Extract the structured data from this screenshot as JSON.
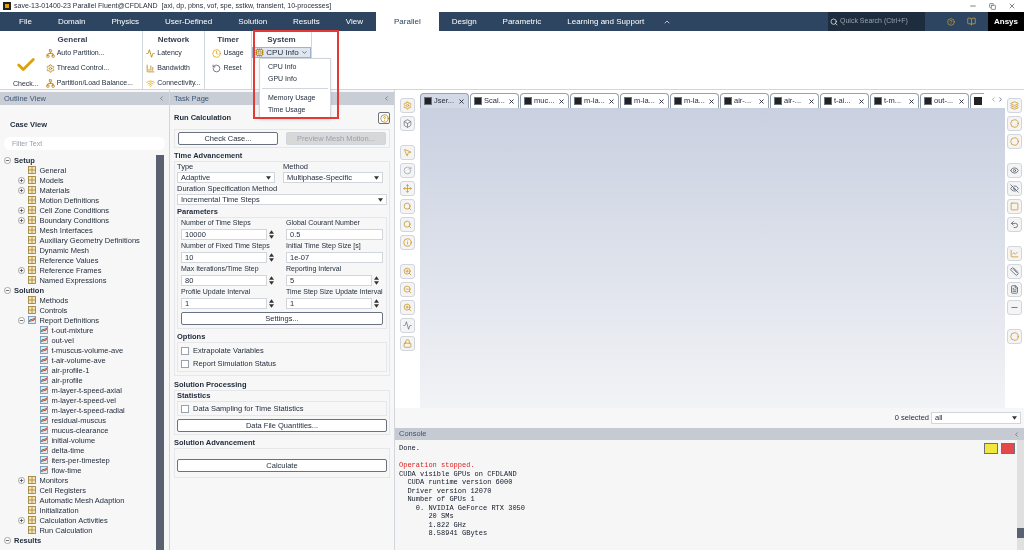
{
  "window": {
    "title": "save-13-01400-23 Parallel Fluent@CFDLAND  [axi, dp, pbns, vof, spe, sstkw, transient, 10-processes]"
  },
  "menu_tabs": [
    {
      "label": "File",
      "selected": false
    },
    {
      "label": "Domain",
      "selected": false
    },
    {
      "label": "Physics",
      "selected": false
    },
    {
      "label": "User-Defined",
      "selected": false
    },
    {
      "label": "Solution",
      "selected": false
    },
    {
      "label": "Results",
      "selected": false
    },
    {
      "label": "View",
      "selected": false
    },
    {
      "label": "Parallel",
      "selected": true
    },
    {
      "label": "Design",
      "selected": false
    },
    {
      "label": "Parametric",
      "selected": false
    },
    {
      "label": "Learning and Support",
      "selected": false
    }
  ],
  "quick_search": {
    "placeholder": "Quick Search (Ctrl+F)"
  },
  "brand": "Ansys",
  "ribbon_groups": [
    {
      "title": "General",
      "items": [
        {
          "label": "Check...",
          "kind": "check"
        },
        {
          "label": "Auto Partition...",
          "kind": "partition"
        },
        {
          "label": "Thread Control...",
          "kind": "thread"
        },
        {
          "label": "Partition/Load Balance...",
          "kind": "balance"
        }
      ]
    },
    {
      "title": "Network",
      "items": [
        {
          "label": "Latency",
          "kind": "latency"
        },
        {
          "label": "Bandwidth",
          "kind": "bandwidth"
        },
        {
          "label": "Connectivity...",
          "kind": "wifi"
        }
      ]
    },
    {
      "title": "Timer",
      "items": [
        {
          "label": "Usage",
          "kind": "usage"
        },
        {
          "label": "Reset",
          "kind": "reset"
        }
      ]
    },
    {
      "title": "System",
      "items": [
        {
          "label": "CPU Info",
          "kind": "dropdown",
          "expanded": true
        }
      ]
    }
  ],
  "system_menu": {
    "option_groups": [
      [
        "CPU Info",
        "GPU Info"
      ],
      [
        "Memory Usage",
        "Time Usage"
      ]
    ]
  },
  "outline_view": {
    "title": "Outline View",
    "subtitle": "Case View",
    "filter": {
      "placeholder": "Filter Text"
    },
    "tree": [
      {
        "label": "Setup",
        "kind": "section",
        "expanded": true,
        "children": [
          {
            "label": "General",
            "kind": "item"
          },
          {
            "label": "Models",
            "kind": "item",
            "expanded": false
          },
          {
            "label": "Materials",
            "kind": "item",
            "expanded": false
          },
          {
            "label": "Motion Definitions",
            "kind": "item"
          },
          {
            "label": "Cell Zone Conditions",
            "kind": "item",
            "expanded": false
          },
          {
            "label": "Boundary Conditions",
            "kind": "item",
            "expanded": false
          },
          {
            "label": "Mesh Interfaces",
            "kind": "item"
          },
          {
            "label": "Auxiliary Geometry Definitions",
            "kind": "item"
          },
          {
            "label": "Dynamic Mesh",
            "kind": "item"
          },
          {
            "label": "Reference Values",
            "kind": "item"
          },
          {
            "label": "Reference Frames",
            "kind": "item",
            "expanded": false
          },
          {
            "label": "Named Expressions",
            "kind": "item"
          }
        ]
      },
      {
        "label": "Solution",
        "kind": "section",
        "expanded": true,
        "children": [
          {
            "label": "Methods",
            "kind": "item"
          },
          {
            "label": "Controls",
            "kind": "item"
          },
          {
            "label": "Report Definitions",
            "kind": "report",
            "expanded": true,
            "children": [
              {
                "label": "t-out-mixture",
                "kind": "report"
              },
              {
                "label": "out-vel",
                "kind": "report"
              },
              {
                "label": "t-muscus-volume-ave",
                "kind": "report"
              },
              {
                "label": "t-air-volume-ave",
                "kind": "report"
              },
              {
                "label": "air-profile-1",
                "kind": "report"
              },
              {
                "label": "air-profile",
                "kind": "report"
              },
              {
                "label": "m-layer-t-speed-axial",
                "kind": "report"
              },
              {
                "label": "m-layer-t-speed-vel",
                "kind": "report"
              },
              {
                "label": "m-layer-t-speed-radial",
                "kind": "report"
              },
              {
                "label": "residual-muscus",
                "kind": "report"
              },
              {
                "label": "mucus-clearance",
                "kind": "report"
              },
              {
                "label": "initial-volume",
                "kind": "report"
              },
              {
                "label": "delta-time",
                "kind": "report"
              },
              {
                "label": "iters-per-timestep",
                "kind": "report"
              },
              {
                "label": "flow-time",
                "kind": "report"
              }
            ]
          },
          {
            "label": "Monitors",
            "kind": "item",
            "expanded": false
          },
          {
            "label": "Cell Registers",
            "kind": "item"
          },
          {
            "label": "Automatic Mesh Adaption",
            "kind": "item"
          },
          {
            "label": "Initialization",
            "kind": "item"
          },
          {
            "label": "Calculation Activities",
            "kind": "item",
            "expanded": false
          },
          {
            "label": "Run Calculation",
            "kind": "item"
          }
        ]
      },
      {
        "label": "Results",
        "kind": "section",
        "expanded": true
      }
    ]
  },
  "task_page": {
    "title": "Task Page",
    "heading": "Run Calculation",
    "top_buttons": [
      {
        "label": "Check Case...",
        "disabled": false
      },
      {
        "label": "Preview Mesh Motion...",
        "disabled": true
      }
    ],
    "time_advancement": {
      "title": "Time Advancement",
      "type": {
        "label": "Type",
        "value": "Adaptive"
      },
      "method": {
        "label": "Method",
        "value": "Multiphase-Specific"
      },
      "duration": {
        "label": "Duration Specification Method",
        "value": "Incremental Time Steps"
      }
    },
    "parameters": {
      "title": "Parameters",
      "fields": [
        {
          "label": "Number of Time Steps",
          "value": "10000",
          "kind": "spinner"
        },
        {
          "label": "Global Courant Number",
          "value": "0.5",
          "kind": "text"
        },
        {
          "label": "Number of Fixed Time Steps",
          "value": "10",
          "kind": "spinner"
        },
        {
          "label": "Initial Time Step Size [s]",
          "value": "1e-07",
          "kind": "text"
        },
        {
          "label": "Max Iterations/Time Step",
          "value": "80",
          "kind": "spinner"
        },
        {
          "label": "Reporting Interval",
          "value": "5",
          "kind": "spinner"
        },
        {
          "label": "Profile Update Interval",
          "value": "1",
          "kind": "spinner"
        },
        {
          "label": "Time Step Size Update Interval",
          "value": "1",
          "kind": "spinner"
        }
      ],
      "button": "Settings..."
    },
    "options": {
      "title": "Options",
      "checkboxes": [
        {
          "label": "Extrapolate Variables",
          "checked": false
        },
        {
          "label": "Report Simulation Status",
          "checked": false
        }
      ]
    },
    "solution_processing": {
      "title": "Solution Processing",
      "statistics_title": "Statistics",
      "checkboxes": [
        {
          "label": "Data Sampling for Time Statistics",
          "checked": false
        }
      ],
      "button": "Data File Quantities..."
    },
    "solution_advancement": {
      "title": "Solution Advancement",
      "button": "Calculate"
    }
  },
  "graphics": {
    "tabs": [
      {
        "label": "Jser...",
        "selected": true
      },
      {
        "label": "Scal...",
        "selected": false
      },
      {
        "label": "muc...",
        "selected": false
      },
      {
        "label": "m-la...",
        "selected": false
      },
      {
        "label": "m-la...",
        "selected": false
      },
      {
        "label": "m-la...",
        "selected": false
      },
      {
        "label": "air-...",
        "selected": false
      },
      {
        "label": "air-...",
        "selected": false
      },
      {
        "label": "t-ai...",
        "selected": false
      },
      {
        "label": "t-m...",
        "selected": false
      },
      {
        "label": "out-...",
        "selected": false
      }
    ],
    "selection_count": "0 selected",
    "selection_filter": "all"
  },
  "console": {
    "title": "Console",
    "lines": [
      {
        "text": "Done.",
        "kind": "normal"
      },
      {
        "text": "Operation stopped.",
        "kind": "error"
      },
      {
        "text": "CUDA visible GPUs on CFDLAND",
        "kind": "normal"
      },
      {
        "text": "  CUDA runtime version 6000",
        "kind": "normal"
      },
      {
        "text": "  Driver version 12070",
        "kind": "normal"
      },
      {
        "text": "  Number of GPUs 1",
        "kind": "normal"
      },
      {
        "text": "    0. NVIDIA GeForce RTX 3050",
        "kind": "normal"
      },
      {
        "text": "       20 SMs",
        "kind": "normal"
      },
      {
        "text": "       1.822 GHz",
        "kind": "normal"
      },
      {
        "text": "       8.58941 GBytes",
        "kind": "normal"
      }
    ]
  }
}
